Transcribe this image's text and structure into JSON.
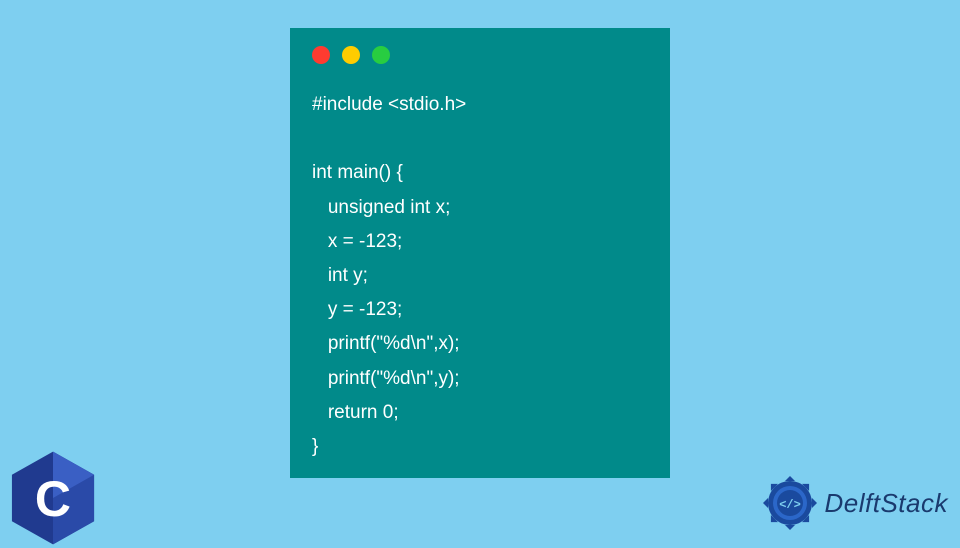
{
  "code": {
    "lines": [
      "#include <stdio.h>",
      "",
      "int main() {",
      "   unsigned int x;",
      "   x = -123;",
      "   int y;",
      "   y = -123;",
      "   printf(\"%d\\n\",x);",
      "   printf(\"%d\\n\",y);",
      "   return 0;",
      "}"
    ]
  },
  "branding": {
    "name": "DelftStack",
    "c_logo_letter": "C"
  },
  "colors": {
    "background": "#7ecff0",
    "window": "#018a8a",
    "code_text": "#ffffff",
    "brand_text": "#1a3a6e",
    "dot_red": "#ff3b30",
    "dot_yellow": "#ffcc00",
    "dot_green": "#28cd41"
  }
}
